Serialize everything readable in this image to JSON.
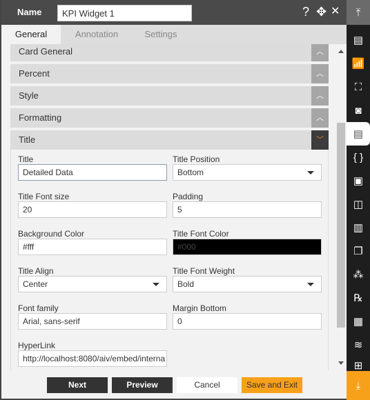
{
  "header": {
    "name_label": "Name",
    "name_value": "KPI Widget 1",
    "help_icon": "?",
    "move_icon": "✥",
    "close_icon": "✕"
  },
  "tabs": [
    {
      "label": "General",
      "active": true
    },
    {
      "label": "Annotation"
    },
    {
      "label": "Settings"
    }
  ],
  "sections": [
    {
      "label": "Card General"
    },
    {
      "label": "Percent"
    },
    {
      "label": "Style"
    },
    {
      "label": "Formatting"
    },
    {
      "label": "Title",
      "expanded": true
    }
  ],
  "fields": [
    {
      "label": "Title",
      "value": "Detailed Data",
      "type": "text"
    },
    {
      "label": "Title Position",
      "value": "Bottom",
      "type": "select"
    },
    {
      "label": "Title Font size",
      "value": "20",
      "type": "text"
    },
    {
      "label": "Padding",
      "value": "5",
      "type": "text"
    },
    {
      "label": "Background Color",
      "value": "#fff",
      "type": "text"
    },
    {
      "label": "Title Font Color",
      "value": "#000",
      "type": "color"
    },
    {
      "label": "Title Align",
      "value": "Center",
      "type": "select"
    },
    {
      "label": "Title Font Weight",
      "value": "Bold",
      "type": "select"
    },
    {
      "label": "Font family",
      "value": "Arial, sans-serif",
      "type": "text"
    },
    {
      "label": "Margin Bottom",
      "value": "0",
      "type": "text"
    },
    {
      "label": "HyperLink",
      "value": "http://localhost:8080/aiv/embed/interna",
      "type": "text"
    }
  ],
  "footer": {
    "next": "Next",
    "preview": "Preview",
    "cancel": "Cancel",
    "save": "Save and Exit"
  },
  "colors": {
    "accent": "#f7a11a",
    "dark": "#333333",
    "header": "#4a4a4a",
    "sidebar": "#1e1e1e"
  },
  "sidebar": {
    "icons": [
      "scroll-top-icon",
      "table-icon",
      "chart-icon",
      "map-icon",
      "report-icon",
      "document-icon",
      "code-braces-icon",
      "image-icon",
      "pivot-icon",
      "bar-chart-icon",
      "copy-icon",
      "cubes-icon",
      "rx-icon",
      "form-icon",
      "layers-icon",
      "grid-icon",
      "scroll-bottom-icon"
    ],
    "active": "document-icon"
  }
}
